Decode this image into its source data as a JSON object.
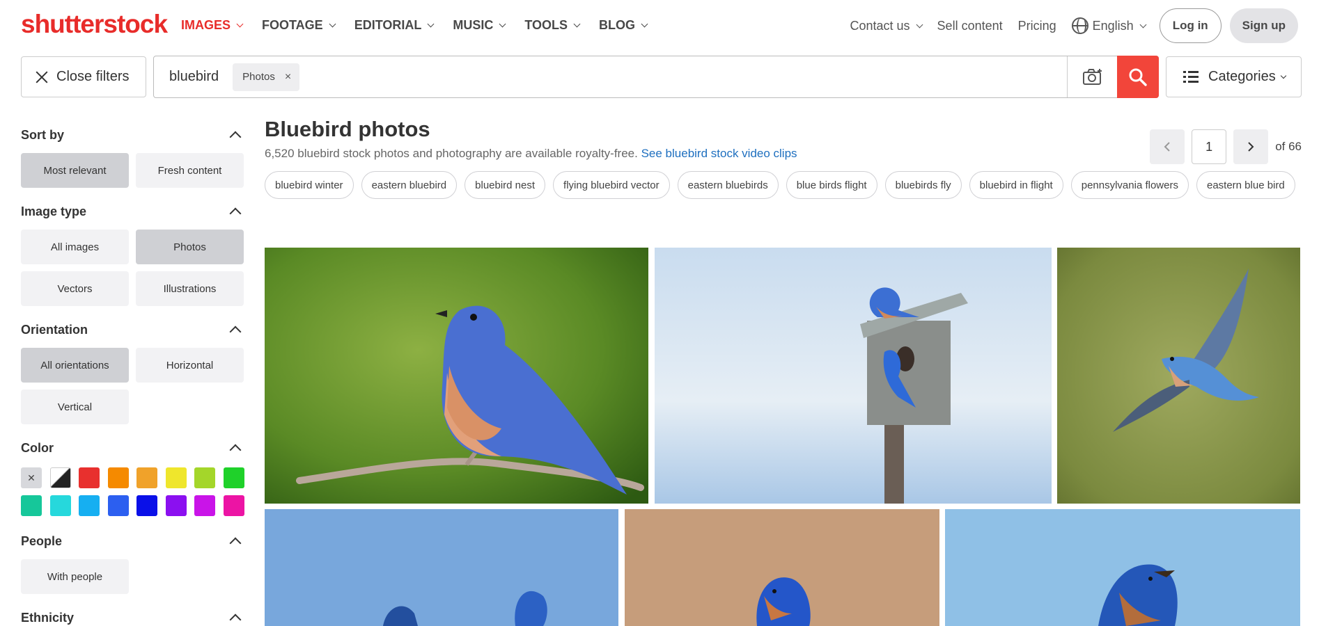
{
  "brand": {
    "logo_text": "shutterstock",
    "accent_color": "#e82c2a"
  },
  "nav": {
    "items": [
      {
        "label": "IMAGES",
        "active": true
      },
      {
        "label": "FOOTAGE",
        "active": false
      },
      {
        "label": "EDITORIAL",
        "active": false
      },
      {
        "label": "MUSIC",
        "active": false
      },
      {
        "label": "TOOLS",
        "active": false
      },
      {
        "label": "BLOG",
        "active": false
      }
    ],
    "contact": "Contact us",
    "sell": "Sell content",
    "pricing": "Pricing",
    "language": "English",
    "login": "Log in",
    "signup": "Sign up"
  },
  "search": {
    "close_filters": "Close filters",
    "query": "bluebird",
    "filter_chip": "Photos",
    "categories": "Categories"
  },
  "sidebar": {
    "sort": {
      "title": "Sort by",
      "options": [
        "Most relevant",
        "Fresh content"
      ],
      "selected": "Most relevant"
    },
    "image_type": {
      "title": "Image type",
      "options": [
        "All images",
        "Photos",
        "Vectors",
        "Illustrations"
      ],
      "selected": "Photos"
    },
    "orientation": {
      "title": "Orientation",
      "options": [
        "All orientations",
        "Horizontal",
        "Vertical"
      ],
      "selected": "All orientations"
    },
    "color": {
      "title": "Color",
      "swatches": [
        "clear",
        "black-white",
        "#e8302e",
        "#f58a00",
        "#f0a22a",
        "#efe62c",
        "#a4d62a",
        "#1fd12a",
        "#16c79a",
        "#26d8dc",
        "#16aff1",
        "#2c5ff0",
        "#0a10e8",
        "#8b10f0",
        "#c914e8",
        "#ec14a4"
      ]
    },
    "people": {
      "title": "People",
      "options": [
        "With people"
      ]
    },
    "ethnicity": {
      "title": "Ethnicity"
    }
  },
  "results": {
    "title": "Bluebird photos",
    "count_text": "6,520 bluebird stock photos and photography are available royalty-free.",
    "video_link": "See bluebird stock video clips",
    "page": "1",
    "of_pages": "of 66",
    "tags": [
      "bluebird winter",
      "eastern bluebird",
      "bluebird nest",
      "flying bluebird vector",
      "eastern bluebirds",
      "blue birds flight",
      "bluebirds fly",
      "bluebird in flight",
      "pennsylvania flowers",
      "eastern blue bird"
    ]
  }
}
